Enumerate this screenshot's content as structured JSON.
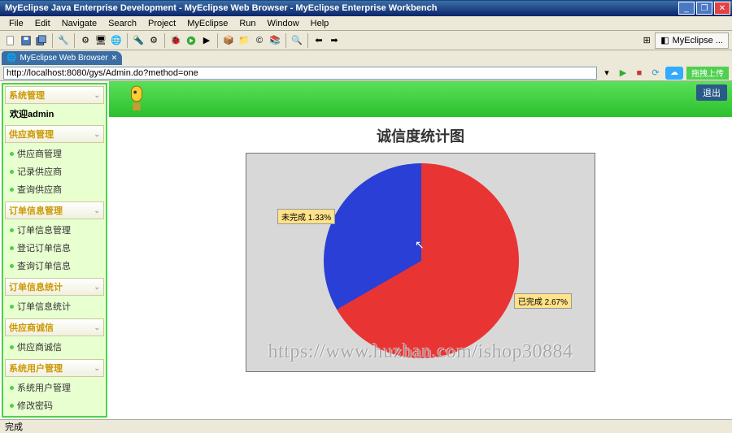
{
  "window": {
    "title": "MyEclipse Java Enterprise Development - MyEclipse Web Browser - MyEclipse Enterprise Workbench"
  },
  "menu": {
    "file": "File",
    "edit": "Edit",
    "navigate": "Navigate",
    "search": "Search",
    "project": "Project",
    "myeclipse": "MyEclipse",
    "run": "Run",
    "window": "Window",
    "help": "Help"
  },
  "perspective": {
    "label": "MyEclipse ..."
  },
  "editor_tab": {
    "label": "MyEclipse Web Browser"
  },
  "address": {
    "url": "http://localhost:8080/gys/Admin.do?method=one"
  },
  "upload_btn": "拖拽上传",
  "sidebar": {
    "groups": [
      {
        "title": "系统管理",
        "items": []
      },
      {
        "title_is_welcome": true,
        "welcome": "欢迎admin"
      },
      {
        "title": "供应商管理",
        "items": [
          "供应商管理",
          "记录供应商",
          "查询供应商"
        ]
      },
      {
        "title": "订单信息管理",
        "items": [
          "订单信息管理",
          "登记订单信息",
          "查询订单信息"
        ]
      },
      {
        "title": "订单信息统计",
        "items": [
          "订单信息统计"
        ]
      },
      {
        "title": "供应商诚信",
        "items": [
          "供应商诚信"
        ]
      },
      {
        "title": "系统用户管理",
        "items": [
          "系统用户管理",
          "修改密码"
        ]
      }
    ]
  },
  "page": {
    "exit": "退出",
    "chart_title": "诚信度统计图",
    "label_incomplete": "未完成 1.33%",
    "label_complete": "已完成 2.67%"
  },
  "chart_data": {
    "type": "pie",
    "title": "诚信度统计图",
    "series": [
      {
        "name": "已完成",
        "value": 2.67,
        "color": "#e93434"
      },
      {
        "name": "未完成",
        "value": 1.33,
        "color": "#2a3fd6"
      }
    ]
  },
  "watermark": "https://www.huzhan.com/ishop30884",
  "status": "完成"
}
